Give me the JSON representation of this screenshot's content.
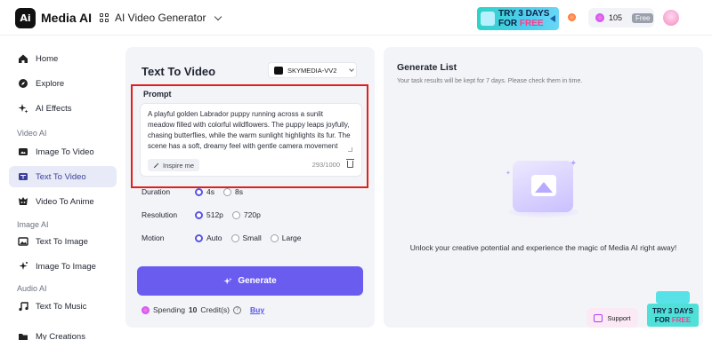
{
  "header": {
    "logo_text": "Media AI",
    "app_switcher": "AI Video Generator",
    "promo_line1": "TRY 3 DAYS",
    "promo_line2_a": "FOR ",
    "promo_line2_b": "FREE",
    "credits": "105",
    "plan_badge": "Free"
  },
  "sidebar": {
    "items": [
      {
        "label": "Home",
        "icon": "home-icon"
      },
      {
        "label": "Explore",
        "icon": "compass-icon"
      },
      {
        "label": "AI Effects",
        "icon": "sparkle-icon"
      }
    ],
    "section_video": "Video AI",
    "video_items": [
      {
        "label": "Image To Video",
        "icon": "image-video-icon"
      },
      {
        "label": "Text To Video",
        "icon": "text-video-icon",
        "active": true
      },
      {
        "label": "Video To Anime",
        "icon": "anime-icon"
      }
    ],
    "section_image": "Image AI",
    "image_items": [
      {
        "label": "Text To Image",
        "icon": "text-image-icon"
      },
      {
        "label": "Image To Image",
        "icon": "image-image-icon"
      }
    ],
    "section_audio": "Audio AI",
    "audio_items": [
      {
        "label": "Text To Music",
        "icon": "music-icon"
      }
    ],
    "bottom_item": "My Creations"
  },
  "main": {
    "title": "Text To Video",
    "model": "SKYMEDIA-VV2",
    "prompt_label": "Prompt",
    "prompt_text": "A playful golden Labrador puppy running across a sunlit meadow filled with colorful wildflowers. The puppy leaps joyfully, chasing butterflies, while the warm sunlight highlights its fur. The scene has a soft, dreamy feel with gentle camera movement and a light bokeh effect in the",
    "inspire_label": "Inspire me",
    "char_count": "293/1000",
    "duration_label": "Duration",
    "duration_options": [
      "4s",
      "8s"
    ],
    "duration_selected": "4s",
    "resolution_label": "Resolution",
    "resolution_options": [
      "512p",
      "720p"
    ],
    "resolution_selected": "512p",
    "motion_label": "Motion",
    "motion_options": [
      "Auto",
      "Small",
      "Large"
    ],
    "motion_selected": "Auto",
    "generate_label": "Generate",
    "spending_prefix": "Spending",
    "spending_amount": "10",
    "spending_suffix": "Credit(s)",
    "buy_label": "Buy"
  },
  "panel": {
    "title": "Generate List",
    "subtitle": "Your task results will be kept for 7 days. Please check them in time.",
    "empty_message": "Unlock your creative potential and experience the magic of Media AI right away!",
    "support_label": "Support",
    "promo_line1": "TRY 3 DAYS",
    "promo_line2_a": "FOR ",
    "promo_line2_b": "FREE"
  },
  "colors": {
    "accent": "#6b5cf0",
    "highlight_frame": "#e0201c",
    "active_nav_bg": "#e8ebf7"
  }
}
